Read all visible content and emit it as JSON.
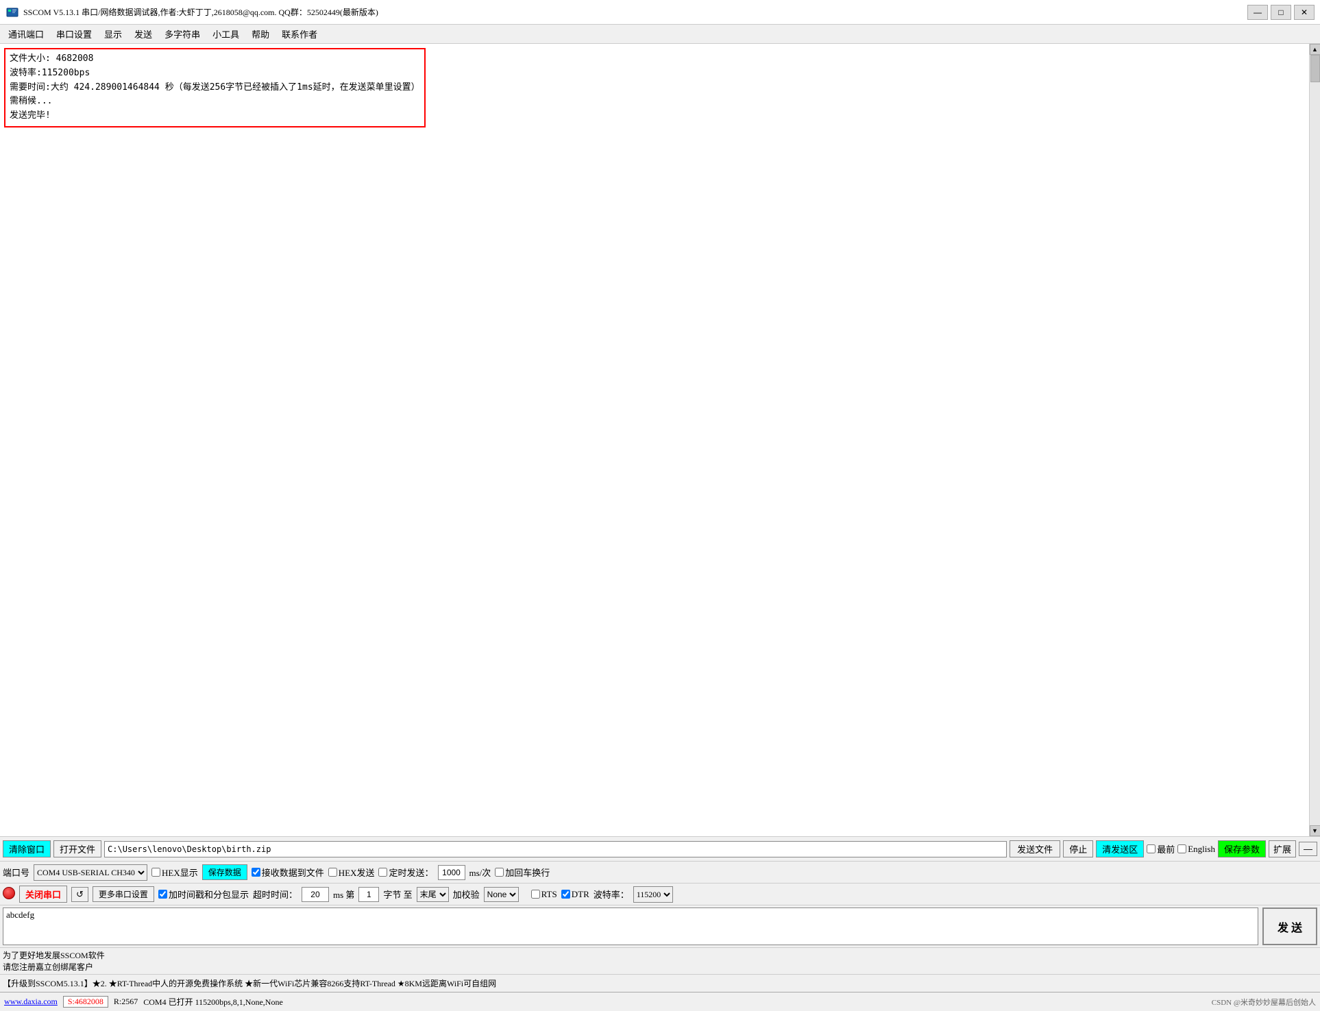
{
  "titleBar": {
    "title": "SSCOM V5.13.1 串口/网络数据调试器,作者:大虾丁丁,2618058@qq.com. QQ群：52502449(最新版本)",
    "minimizeLabel": "—",
    "restoreLabel": "□",
    "closeLabel": "✕"
  },
  "menuBar": {
    "items": [
      "通讯端口",
      "串口设置",
      "显示",
      "发送",
      "多字符串",
      "小工具",
      "帮助",
      "联系作者"
    ]
  },
  "logArea": {
    "lines": [
      "文件大小: 4682008",
      "波特率:115200bps",
      "需要时间:大约 424.289001464844 秒（每发送256字节已经被插入了1ms延时，在发送菜单里设置）",
      "需稍候...",
      "发送完毕!"
    ]
  },
  "sendFileRow": {
    "clearWindowLabel": "清除窗口",
    "openFileLabel": "打开文件",
    "filePath": "C:\\Users\\lenovo\\Desktop\\birth.zip",
    "sendFileLabel": "发送文件",
    "stopLabel": "停止",
    "clearSendLabel": "清发送区",
    "lastCheckLabel": "最前",
    "englishCheckLabel": "English",
    "saveParamsLabel": "保存参数",
    "expandLabel": "扩展",
    "minusLabel": "—"
  },
  "comRow": {
    "portLabel": "端口号",
    "portValue": "COM4 USB-SERIAL CH340",
    "hexDisplayLabel": "HEX显示",
    "saveDataLabel": "保存数据",
    "receiveToFileLabel": "接收数据到文件",
    "hexSendLabel": "HEX发送",
    "timedSendLabel": "定时发送：",
    "timedSendValue": "1000",
    "timedSendUnit": "ms/次",
    "carriageReturnLabel": "加回车换行",
    "timeoutLabel": "超时时间：",
    "timeoutValue": "20",
    "timeoutUnit": "ms 第",
    "byteFromValue": "1",
    "byteLabel": "字节 至",
    "byteToLabel": "末尾",
    "checksumLabel": "加校验",
    "checksumValue": "None"
  },
  "controlRow": {
    "closePortLabel": "关闭串口",
    "refreshLabel": "↺",
    "moreSettingsLabel": "更多串口设置",
    "addTimestampLabel": "加时间戳和分包显示",
    "rtsLabel": "RTS",
    "dtrLabel": "DTR",
    "baudLabel": "波特率：",
    "baudValue": "115200"
  },
  "sendArea": {
    "textValue": "abcdefg",
    "sendLabel": "发 送"
  },
  "promoRow": {
    "text": "为了更好地发展SSCOM软件\n请您注册嘉立创绑尾客户"
  },
  "tickerText": "【升级到SSCOM5.13.1】★2. ★RT-Thread中人的开源免费操作系统 ★新一代WiFi芯片兼容8266支持RT-Thread ★8KM远距离WiFi可自组网",
  "statusBar": {
    "website": "www.daxia.com",
    "sendCount": "S:4682008",
    "receiveCount": "R:2567",
    "portInfo": "COM4 已打开  115200bps,8,1,None,None",
    "credit": "CSDN @米奇妙妙屋幕后创始人"
  }
}
